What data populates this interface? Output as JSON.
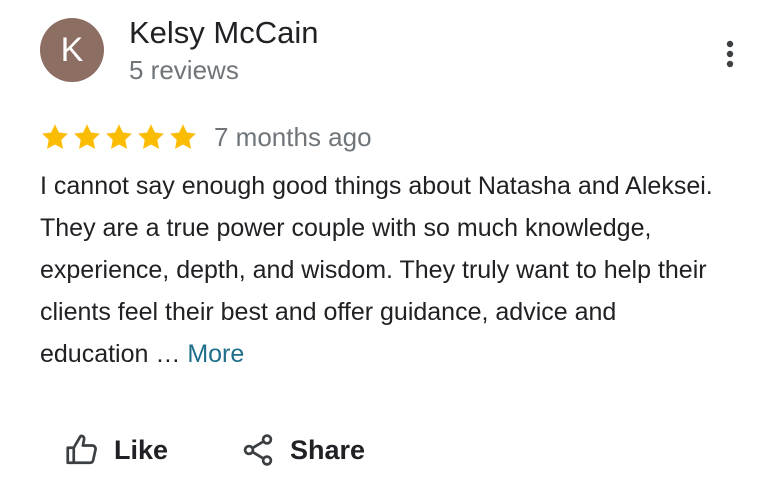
{
  "reviewer": {
    "initial": "K",
    "name": "Kelsy McCain",
    "meta": "5 reviews",
    "avatar_color": "#8d6e63"
  },
  "menu": {
    "icon": "more-vert-icon"
  },
  "rating": {
    "stars": 5,
    "max_stars": 5,
    "star_color": "#fbbc04",
    "time_ago": "7 months ago"
  },
  "review": {
    "text": "I cannot say enough good things about Natasha and Aleksei. They are a true power couple with so much knowledge, experience, depth, and wisdom. They truly want to help their clients feel their best and offer guidance, advice and education … ",
    "more_label": "More",
    "more_color": "#1f6f8b"
  },
  "actions": {
    "like": {
      "label": "Like",
      "icon": "thumbs-up-icon"
    },
    "share": {
      "label": "Share",
      "icon": "share-icon"
    }
  }
}
